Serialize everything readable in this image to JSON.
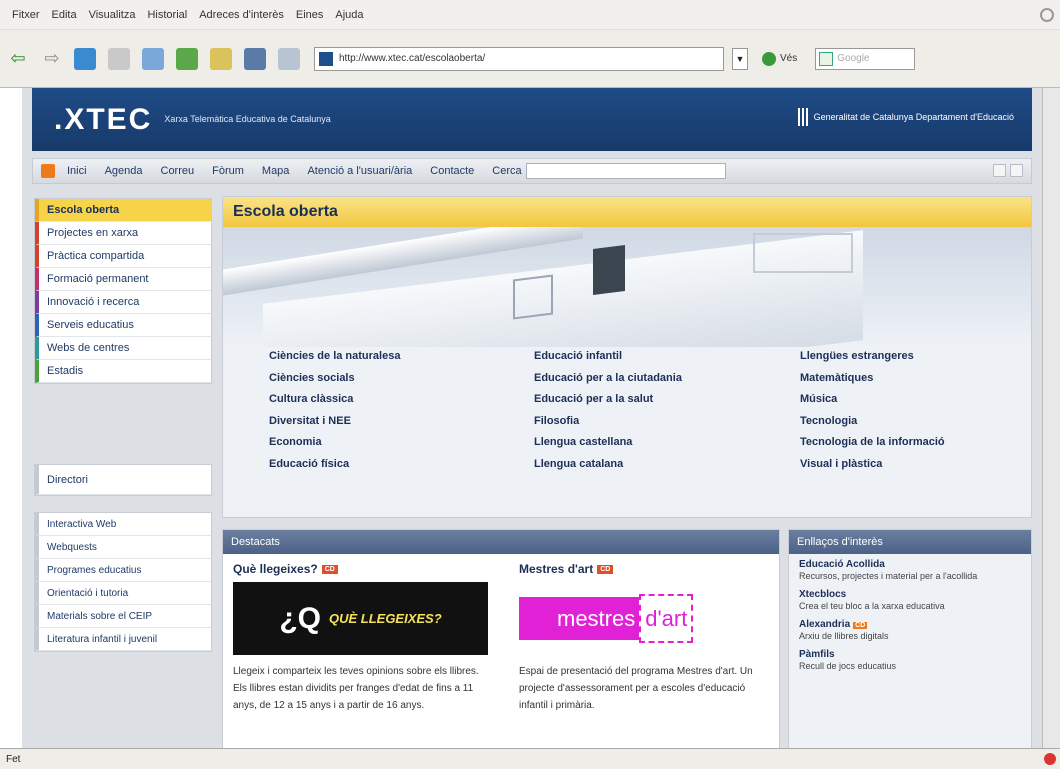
{
  "browser": {
    "menu": [
      "Fitxer",
      "Edita",
      "Visualitza",
      "Historial",
      "Adreces d'interès",
      "Eines",
      "Ajuda"
    ],
    "url": "http://www.xtec.cat/escolaoberta/",
    "go_label": "Vés",
    "search_placeholder": "Google",
    "status": "Fet"
  },
  "site": {
    "logo": ".XTEC",
    "logo_sub": "Xarxa Telemàtica Educativa de Catalunya",
    "gencat": "Generalitat de Catalunya Departament d'Educació",
    "nav": [
      "Inici",
      "Agenda",
      "Correu",
      "Fòrum",
      "Mapa",
      "Atenció a l'usuari/ària",
      "Contacte"
    ],
    "search_label": "Cerca"
  },
  "sidebar": {
    "main": [
      "Escola oberta",
      "Projectes en xarxa",
      "Pràctica compartida",
      "Formació permanent",
      "Innovació i recerca",
      "Serveis educatius",
      "Webs de centres",
      "Estadis"
    ],
    "directori": "Directori",
    "other": [
      "Interactiva Web",
      "Webquests",
      "Programes educatius",
      "Orientació i tutoria",
      "Materials sobre el CEIP",
      "Literatura infantil i juvenil"
    ]
  },
  "escola_oberta": {
    "title": "Escola oberta",
    "col1": [
      "Ciències de la naturalesa",
      "Ciències socials",
      "Cultura clàssica",
      "Diversitat i NEE",
      "Economia",
      "Educació física"
    ],
    "col2": [
      "Educació infantil",
      "Educació per a la ciutadania",
      "Educació per a la salut",
      "Filosofia",
      "Llengua castellana",
      "Llengua catalana"
    ],
    "col3": [
      "Llengües estrangeres",
      "Matemàtiques",
      "Música",
      "Tecnologia",
      "Tecnologia de la informació",
      "Visual i plàstica"
    ]
  },
  "destacats": {
    "title": "Destacats",
    "f1_title": "Què llegeixes?",
    "f1_badge": "CD",
    "f1_img_big": "¿Q",
    "f1_img_small": "QUÈ LLEGEIXES?",
    "f1_desc": "Llegeix i comparteix les teves opinions sobre els llibres. Els llibres estan dividits per franges d'edat de fins a 11 anys, de 12 a 15 anys i a partir de 16 anys.",
    "f2_title": "Mestres d'art",
    "f2_badge": "CD",
    "f2_img_l": "mestres",
    "f2_img_r": "d'art",
    "f2_desc": "Espai de presentació del programa Mestres d'art. Un projecte d'assessorament per a escoles d'educació infantil i primària."
  },
  "links": {
    "title": "Enllaços d'interès",
    "items": [
      {
        "t": "Educació Acollida",
        "d": "Recursos, projectes i material per a l'acollida"
      },
      {
        "t": "Xtecblocs",
        "d": "Crea el teu bloc a la xarxa educativa"
      },
      {
        "t": "Alexandria",
        "d": "Arxiu de llibres digitals",
        "badge": "CD"
      },
      {
        "t": "Pàmfils",
        "d": "Recull de jocs educatius"
      }
    ]
  },
  "colors": {
    "header": "#1f4b86",
    "accent_yellow": "#f2c63d",
    "magenta": "#e021d6"
  }
}
